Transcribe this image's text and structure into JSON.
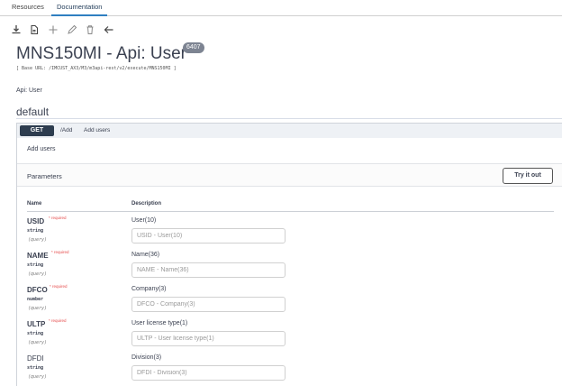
{
  "tabs": [
    {
      "label": "Resources",
      "active": false
    },
    {
      "label": "Documentation",
      "active": true
    }
  ],
  "toolbar": {
    "icons": [
      "download-icon",
      "export-icon",
      "add-icon",
      "edit-icon",
      "delete-icon",
      "back-icon"
    ]
  },
  "header": {
    "title": "MNS150MI - Api: User",
    "version": "6407",
    "base_url": "[ Base URL: /IMCUST_AX3/M3/m3api-rest/v2/execute/MNS150MI ]"
  },
  "api_description": "Api: User",
  "section": {
    "title": "default"
  },
  "operation": {
    "method": "GET",
    "path": "/Add",
    "summary": "Add users",
    "description": "Add users",
    "parameters_label": "Parameters",
    "try_label": "Try it out",
    "columns": {
      "name": "Name",
      "description": "Description"
    },
    "params": [
      {
        "name": "USID",
        "required": true,
        "required_label": "* required",
        "type": "string",
        "in": "(query)",
        "description": "User(10)",
        "placeholder": "USID - User(10)"
      },
      {
        "name": "NAME",
        "required": true,
        "required_label": "* required",
        "type": "string",
        "in": "(query)",
        "description": "Name(36)",
        "placeholder": "NAME - Name(36)"
      },
      {
        "name": "DFCO",
        "required": true,
        "required_label": "* required",
        "type": "number",
        "in": "(query)",
        "description": "Company(3)",
        "placeholder": "DFCO - Company(3)"
      },
      {
        "name": "ULTP",
        "required": true,
        "required_label": "* required",
        "type": "string",
        "in": "(query)",
        "description": "User license type(1)",
        "placeholder": "ULTP - User license type(1)"
      },
      {
        "name": "DFDI",
        "required": false,
        "required_label": "",
        "type": "string",
        "in": "(query)",
        "description": "Division(3)",
        "placeholder": "DFDI - Division(3)"
      }
    ]
  },
  "colors": {
    "accent": "#2f7fc1",
    "method_bg": "#2e3d4f",
    "required": "#e54b4b"
  }
}
